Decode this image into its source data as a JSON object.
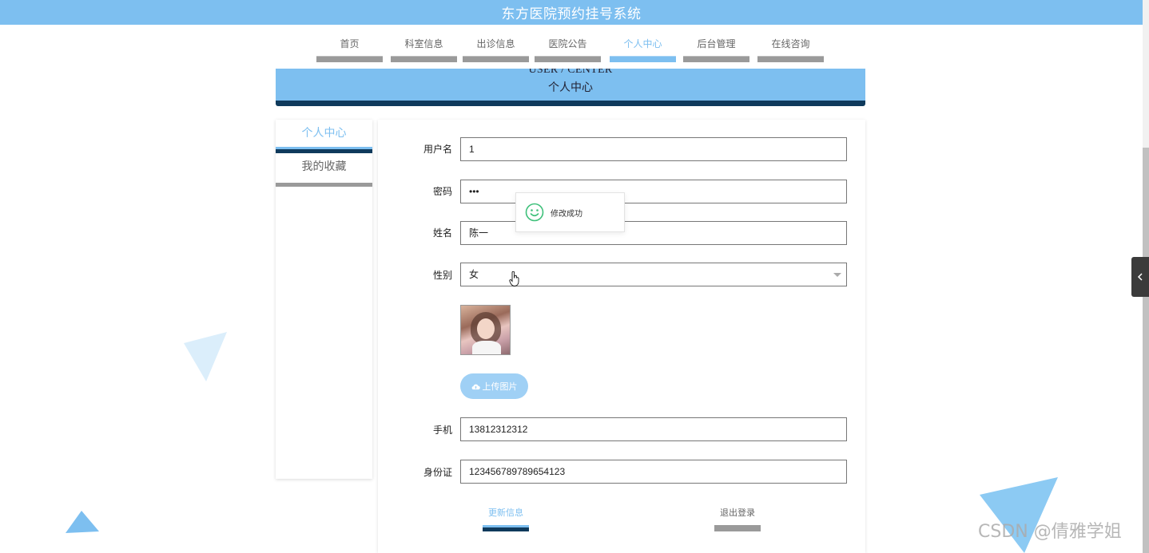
{
  "app": {
    "title": "东方医院预约挂号系统"
  },
  "nav": {
    "items": [
      {
        "label": "首页",
        "active": false
      },
      {
        "label": "科室信息",
        "active": false
      },
      {
        "label": "出诊信息",
        "active": false
      },
      {
        "label": "医院公告",
        "active": false
      },
      {
        "label": "个人中心",
        "active": true
      },
      {
        "label": "后台管理",
        "active": false
      },
      {
        "label": "在线咨询",
        "active": false
      }
    ]
  },
  "banner": {
    "en": "USER / CENTER",
    "cn": "个人中心"
  },
  "sidebar": {
    "items": [
      {
        "label": "个人中心",
        "active": true
      },
      {
        "label": "我的收藏",
        "active": false
      }
    ]
  },
  "form": {
    "username": {
      "label": "用户名",
      "value": "1"
    },
    "password": {
      "label": "密码",
      "value": "•••"
    },
    "name": {
      "label": "姓名",
      "value": "陈一"
    },
    "gender": {
      "label": "性别",
      "value": "女"
    },
    "upload_label": "上传图片",
    "phone": {
      "label": "手机",
      "value": "13812312312"
    },
    "id_card": {
      "label": "身份证",
      "value": "123456789789654123"
    }
  },
  "actions": {
    "update_label": "更新信息",
    "logout_label": "退出登录"
  },
  "toast": {
    "message": "修改成功",
    "icon": "smile-icon"
  },
  "watermark": "CSDN @倩雅学姐",
  "colors": {
    "primary": "#7dbff0",
    "dark": "#0f3a5c",
    "inactive_bar": "#9a9a9a"
  }
}
